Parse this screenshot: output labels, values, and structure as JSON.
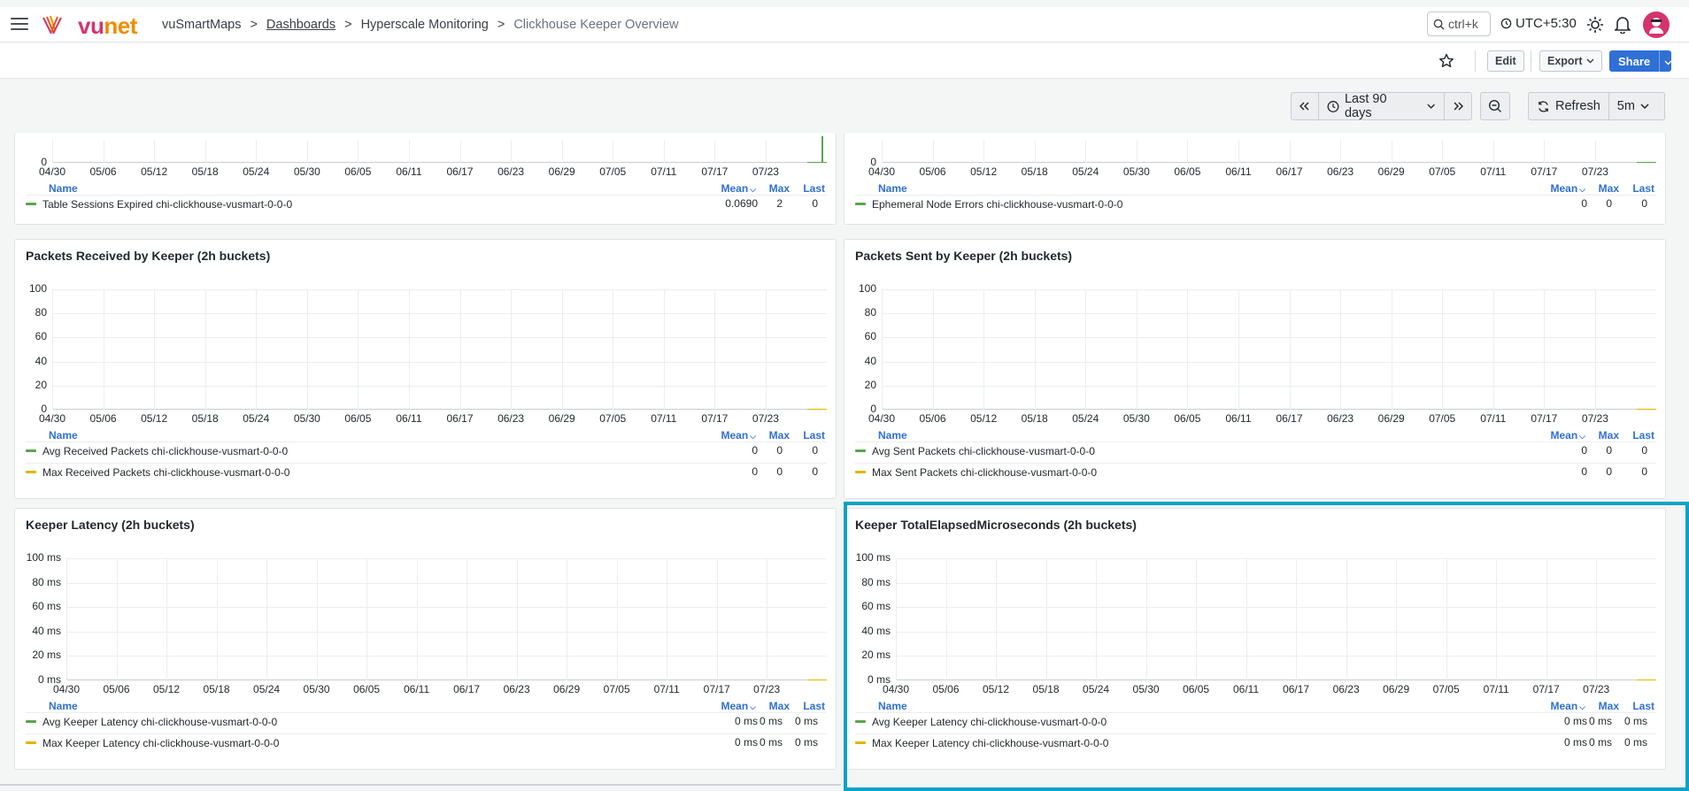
{
  "header": {
    "brand": {
      "v": "v",
      "u": "u",
      "net": "net"
    },
    "breadcrumb": [
      "vuSmartMaps",
      "Dashboards",
      "Hyperscale Monitoring",
      "Clickhouse Keeper Overview"
    ],
    "breadcrumb_sep": ">",
    "search_placeholder": "ctrl+k",
    "timezone": "UTC+5:30"
  },
  "toolbar": {
    "edit_label": "Edit",
    "export_label": "Export",
    "share_label": "Share"
  },
  "timepicker": {
    "range_label": "Last 90 days",
    "refresh_label": "Refresh",
    "interval_label": "5m"
  },
  "x_dates": [
    "04/30",
    "05/06",
    "05/12",
    "05/18",
    "05/24",
    "05/30",
    "06/05",
    "06/11",
    "06/17",
    "06/23",
    "06/29",
    "07/05",
    "07/11",
    "07/17",
    "07/23"
  ],
  "legend_headers": {
    "name": "Name",
    "mean": "Mean",
    "max": "Max",
    "last": "Last"
  },
  "panels": {
    "table_sessions": {
      "y_bottom": "0",
      "rows": [
        {
          "name": "Table Sessions Expired chi-clickhouse-vusmart-0-0-0",
          "mean": "0.0690",
          "max": "2",
          "last": "0",
          "color": "#56a64b"
        }
      ]
    },
    "ephemeral": {
      "y_bottom": "0",
      "rows": [
        {
          "name": "Ephemeral Node Errors chi-clickhouse-vusmart-0-0-0",
          "mean": "0",
          "max": "0",
          "last": "0",
          "color": "#56a64b"
        }
      ]
    },
    "packets_received": {
      "title": "Packets Received by Keeper (2h buckets)",
      "y_ticks": [
        "100",
        "80",
        "60",
        "40",
        "20",
        "0"
      ],
      "rows": [
        {
          "name": "Avg Received Packets chi-clickhouse-vusmart-0-0-0",
          "mean": "0",
          "max": "0",
          "last": "0",
          "color": "#56a64b"
        },
        {
          "name": "Max Received Packets chi-clickhouse-vusmart-0-0-0",
          "mean": "0",
          "max": "0",
          "last": "0",
          "color": "#e0b400"
        }
      ]
    },
    "packets_sent": {
      "title": "Packets Sent by Keeper (2h buckets)",
      "y_ticks": [
        "100",
        "80",
        "60",
        "40",
        "20",
        "0"
      ],
      "rows": [
        {
          "name": "Avg Sent Packets chi-clickhouse-vusmart-0-0-0",
          "mean": "0",
          "max": "0",
          "last": "0",
          "color": "#56a64b"
        },
        {
          "name": "Max Sent Packets chi-clickhouse-vusmart-0-0-0",
          "mean": "0",
          "max": "0",
          "last": "0",
          "color": "#e0b400"
        }
      ]
    },
    "keeper_latency": {
      "title": "Keeper Latency (2h buckets)",
      "y_ticks": [
        "100 ms",
        "80 ms",
        "60 ms",
        "40 ms",
        "20 ms",
        "0 ms"
      ],
      "rows": [
        {
          "name": "Avg Keeper Latency chi-clickhouse-vusmart-0-0-0",
          "mean": "0 ms",
          "max": "0 ms",
          "last": "0 ms",
          "color": "#56a64b"
        },
        {
          "name": "Max Keeper Latency chi-clickhouse-vusmart-0-0-0",
          "mean": "0 ms",
          "max": "0 ms",
          "last": "0 ms",
          "color": "#e0b400"
        }
      ]
    },
    "elapsed": {
      "title": "Keeper TotalElapsedMicroseconds (2h buckets)",
      "y_ticks": [
        "100 ms",
        "80 ms",
        "60 ms",
        "40 ms",
        "20 ms",
        "0 ms"
      ],
      "rows": [
        {
          "name": "Avg Keeper Latency chi-clickhouse-vusmart-0-0-0",
          "mean": "0 ms",
          "max": "0 ms",
          "last": "0 ms",
          "color": "#56a64b"
        },
        {
          "name": "Max Keeper Latency chi-clickhouse-vusmart-0-0-0",
          "mean": "0 ms",
          "max": "0 ms",
          "last": "0 ms",
          "color": "#e0b400"
        }
      ]
    }
  },
  "colors": {
    "accent": "#2f6fd6",
    "highlight": "#0aa2c6",
    "green": "#56a64b",
    "yellow": "#e0b400"
  }
}
